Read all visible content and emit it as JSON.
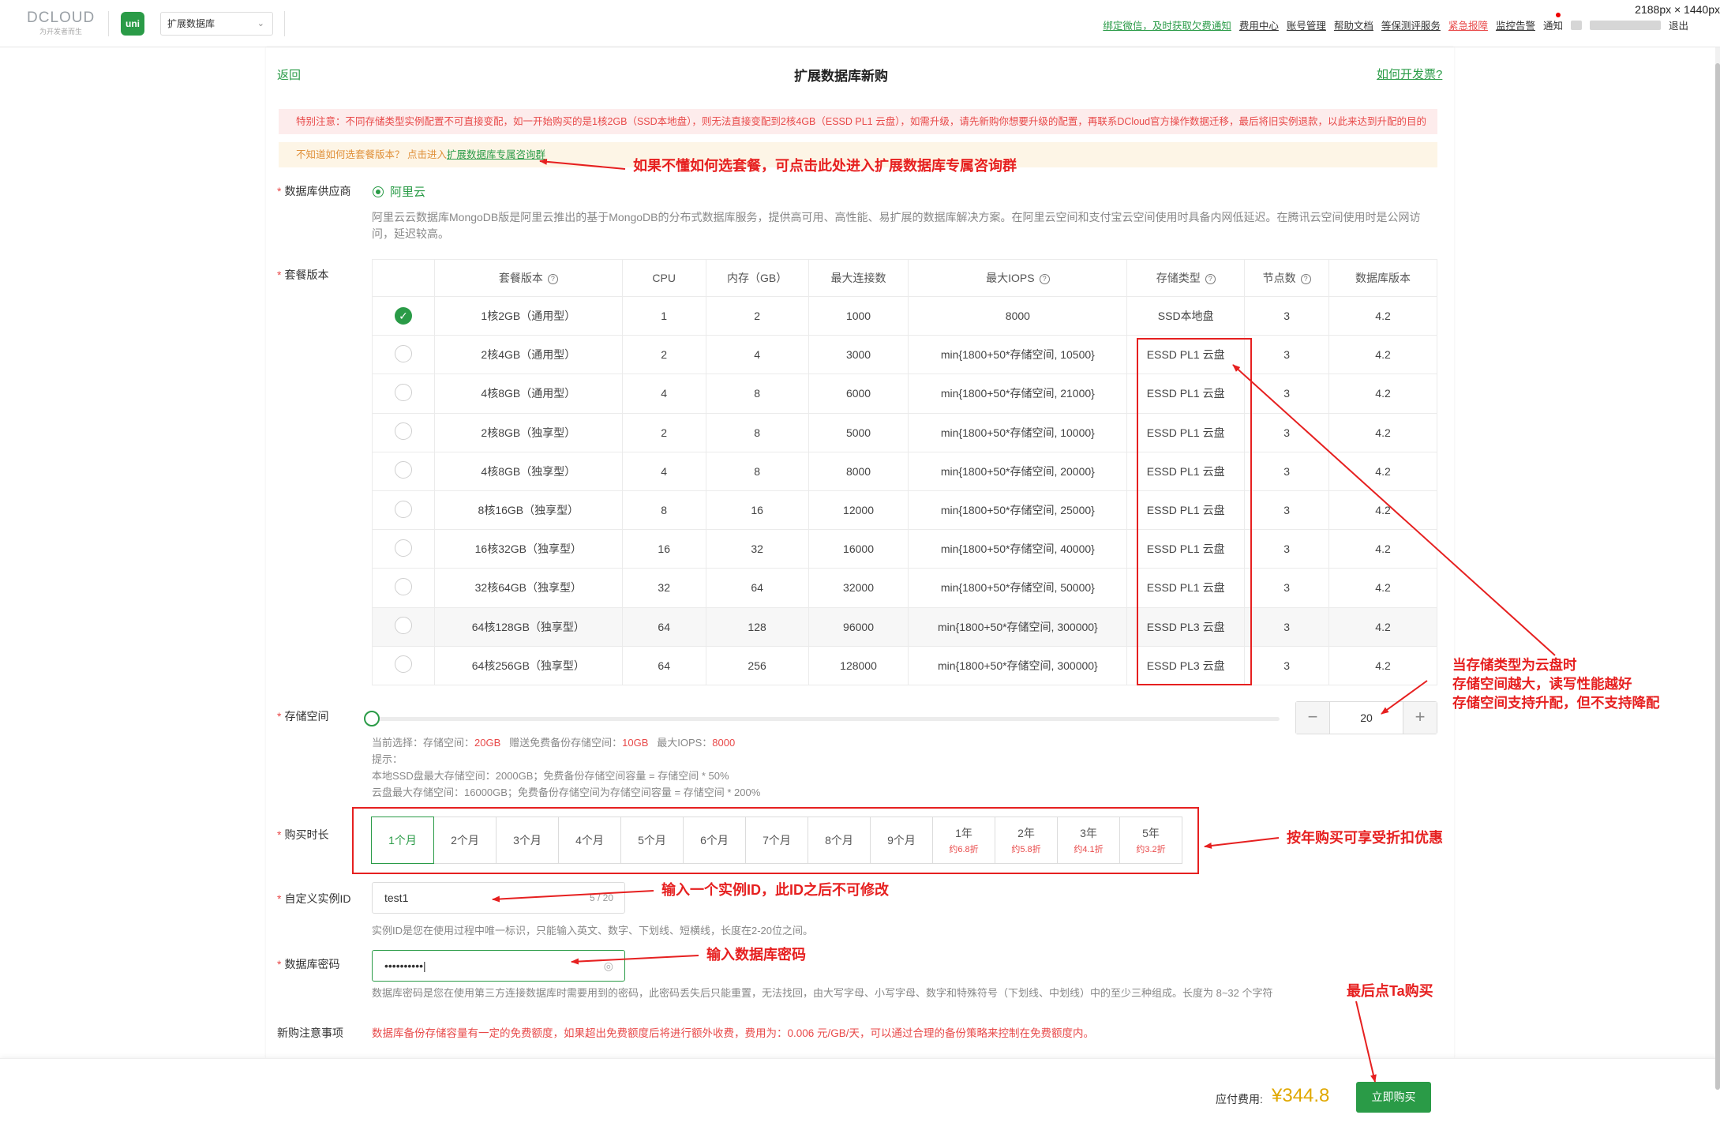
{
  "topbar": {
    "logo_text": "DCLOUD",
    "logo_sub": "为开发者而生",
    "app_badge": "uni",
    "app_select": "扩展数据库",
    "links": {
      "wechat": "绑定微信，及时获取欠费通知",
      "cost": "费用中心",
      "account": "账号管理",
      "help": "帮助文档",
      "security": "等保测评服务",
      "emergency": "紧急报障",
      "monitor": "监控告警",
      "notify": "通知",
      "logout": "退出"
    },
    "dimensions": "2188px × 1440px"
  },
  "header": {
    "back": "返回",
    "title": "扩展数据库新购",
    "invoice": "如何开发票?"
  },
  "notices": {
    "red": "特别注意：不同存储类型实例配置不可直接变配，如一开始购买的是1核2GB（SSD本地盘），则无法直接变配到2核4GB（ESSD PL1 云盘），如需升级，请先新购你想要升级的配置，再联系DCloud官方操作数据迁移，最后将旧实例退款，以此来达到升配的目的",
    "yellow_prefix": "不知道如何选套餐版本？ 点击进入",
    "yellow_link": "扩展数据库专属咨询群"
  },
  "provider": {
    "label": "数据库供应商",
    "option": "阿里云",
    "description": "阿里云云数据库MongoDB版是阿里云推出的基于MongoDB的分布式数据库服务，提供高可用、高性能、易扩展的数据库解决方案。在阿里云空间和支付宝云空间使用时具备内网低延迟。在腾讯云空间使用时是公网访问，延迟较高。"
  },
  "plans": {
    "label": "套餐版本",
    "headers": {
      "version": "套餐版本",
      "cpu": "CPU",
      "memory": "内存（GB）",
      "conn": "最大连接数",
      "iops": "最大IOPS",
      "storage": "存储类型",
      "nodes": "节点数",
      "dbver": "数据库版本"
    },
    "rows": [
      {
        "name": "1核2GB（通用型）",
        "cpu": "1",
        "mem": "2",
        "conn": "1000",
        "iops": "8000",
        "storage": "SSD本地盘",
        "nodes": "3",
        "ver": "4.2",
        "selected": true
      },
      {
        "name": "2核4GB（通用型）",
        "cpu": "2",
        "mem": "4",
        "conn": "3000",
        "iops": "min{1800+50*存储空间, 10500}",
        "storage": "ESSD PL1 云盘",
        "nodes": "3",
        "ver": "4.2"
      },
      {
        "name": "4核8GB（通用型）",
        "cpu": "4",
        "mem": "8",
        "conn": "6000",
        "iops": "min{1800+50*存储空间, 21000}",
        "storage": "ESSD PL1 云盘",
        "nodes": "3",
        "ver": "4.2"
      },
      {
        "name": "2核8GB（独享型）",
        "cpu": "2",
        "mem": "8",
        "conn": "5000",
        "iops": "min{1800+50*存储空间, 10000}",
        "storage": "ESSD PL1 云盘",
        "nodes": "3",
        "ver": "4.2"
      },
      {
        "name": "4核8GB（独享型）",
        "cpu": "4",
        "mem": "8",
        "conn": "8000",
        "iops": "min{1800+50*存储空间, 20000}",
        "storage": "ESSD PL1 云盘",
        "nodes": "3",
        "ver": "4.2"
      },
      {
        "name": "8核16GB（独享型）",
        "cpu": "8",
        "mem": "16",
        "conn": "12000",
        "iops": "min{1800+50*存储空间, 25000}",
        "storage": "ESSD PL1 云盘",
        "nodes": "3",
        "ver": "4.2"
      },
      {
        "name": "16核32GB（独享型）",
        "cpu": "16",
        "mem": "32",
        "conn": "16000",
        "iops": "min{1800+50*存储空间, 40000}",
        "storage": "ESSD PL1 云盘",
        "nodes": "3",
        "ver": "4.2"
      },
      {
        "name": "32核64GB（独享型）",
        "cpu": "32",
        "mem": "64",
        "conn": "32000",
        "iops": "min{1800+50*存储空间, 50000}",
        "storage": "ESSD PL1 云盘",
        "nodes": "3",
        "ver": "4.2"
      },
      {
        "name": "64核128GB（独享型）",
        "cpu": "64",
        "mem": "128",
        "conn": "96000",
        "iops": "min{1800+50*存储空间, 300000}",
        "storage": "ESSD PL3 云盘",
        "nodes": "3",
        "ver": "4.2",
        "highlight": true
      },
      {
        "name": "64核256GB（独享型）",
        "cpu": "64",
        "mem": "256",
        "conn": "128000",
        "iops": "min{1800+50*存储空间, 300000}",
        "storage": "ESSD PL3 云盘",
        "nodes": "3",
        "ver": "4.2"
      }
    ]
  },
  "storage": {
    "label": "存储空间",
    "value": "20",
    "minus": "−",
    "plus": "+",
    "slider_fraction": 0,
    "current_prefix": "当前选择：存储空间：",
    "current_storage": "20GB",
    "backup_prefix": "赠送免费备份存储空间：",
    "backup_value": "10GB",
    "iops_prefix": "最大IOPS：",
    "iops_value": "8000",
    "tip_title": "提示：",
    "tip_local": "本地SSD盘最大存储空间：2000GB；免费备份存储空间容量 = 存储空间 * 50%",
    "tip_cloud": "云盘最大存储空间：16000GB；免费备份存储空间为存储空间容量 = 存储空间 * 200%"
  },
  "duration": {
    "label": "购买时长",
    "options": [
      {
        "label": "1个月",
        "selected": true
      },
      {
        "label": "2个月"
      },
      {
        "label": "3个月"
      },
      {
        "label": "4个月"
      },
      {
        "label": "5个月"
      },
      {
        "label": "6个月"
      },
      {
        "label": "7个月"
      },
      {
        "label": "8个月"
      },
      {
        "label": "9个月"
      },
      {
        "label": "1年",
        "discount": "约6.8折"
      },
      {
        "label": "2年",
        "discount": "约5.8折"
      },
      {
        "label": "3年",
        "discount": "约4.1折"
      },
      {
        "label": "5年",
        "discount": "约3.2折"
      }
    ]
  },
  "instance": {
    "label": "自定义实例ID",
    "value": "test1",
    "counter": "5 / 20",
    "hint": "实例ID是您在使用过程中唯一标识，只能输入英文、数字、下划线、短横线，长度在2-20位之间。"
  },
  "password": {
    "label": "数据库密码",
    "value": "••••••••••",
    "hint": "数据库密码是您在使用第三方连接数据库时需要用到的密码，此密码丢失后只能重置，无法找回，由大写字母、小写字母、数字和特殊符号（下划线、中划线）中的至少三种组成。长度为 8~32 个字符"
  },
  "notes": {
    "label": "新购注意事项",
    "text": "数据库备份存储容量有一定的免费额度，如果超出免费额度后将进行额外收费，费用为：0.006 元/GB/天，可以通过合理的备份策略来控制在免费额度内。"
  },
  "footer": {
    "fee_label": "应付费用:",
    "fee_value": "¥344.8",
    "buy": "立即购买"
  },
  "annotations": {
    "consult": "如果不懂如何选套餐，可点击此处进入扩展数据库专属咨询群",
    "storage_line1": "当存储类型为云盘时",
    "storage_line2": "存储空间越大，读写性能越好",
    "storage_line3": "存储空间支持升配，但不支持降配",
    "discount": "按年购买可享受折扣优惠",
    "instance": "输入一个实例ID，此ID之后不可修改",
    "password": "输入数据库密码",
    "buy": "最后点Ta购买"
  },
  "colors": {
    "brand_green": "#2a9b47",
    "warning_red": "#e84949",
    "annotation_red": "#e62020",
    "price_gold": "#e0a800"
  }
}
